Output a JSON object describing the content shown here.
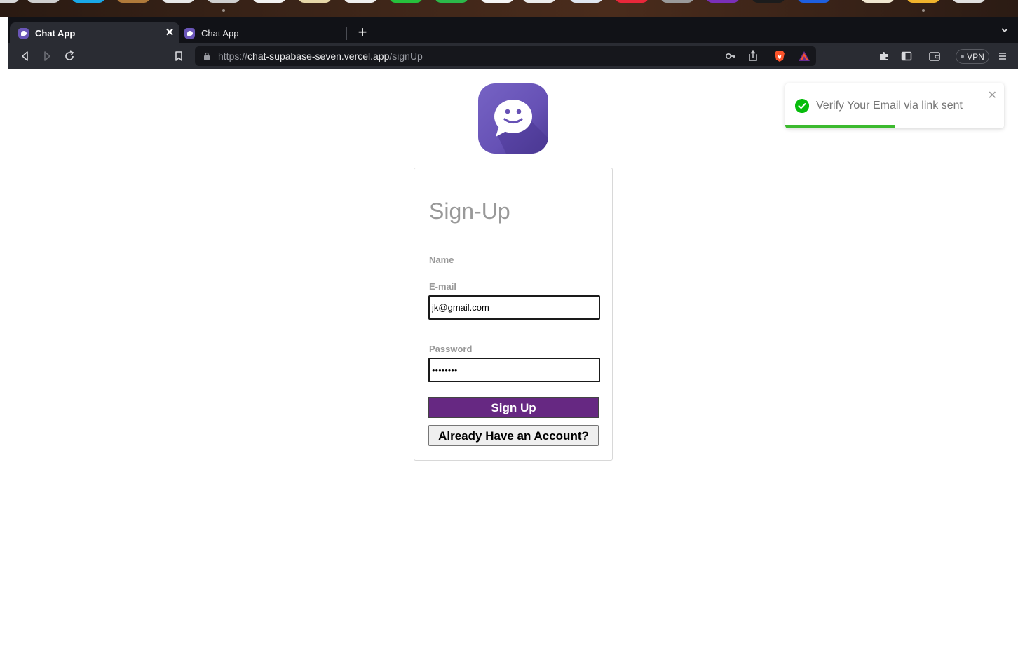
{
  "browser": {
    "tabs": [
      {
        "label": "Chat App",
        "active": true
      },
      {
        "label": "Chat App",
        "active": false
      }
    ],
    "address": {
      "scheme": "https://",
      "host": "chat-supabase-seven.vercel.app",
      "path": "/signUp"
    },
    "vpn_label": "VPN"
  },
  "signup": {
    "title": "Sign-Up",
    "name_label": "Name",
    "email_label": "E-mail",
    "email_value": "jk@gmail.com",
    "password_label": "Password",
    "password_value": "password",
    "signup_button": "Sign Up",
    "login_button": "Already Have an Account?"
  },
  "toast": {
    "message": "Verify Your Email via link sent",
    "progress_fraction": 0.5
  },
  "colors": {
    "brand_purple": "#662882",
    "logo_purple": "#6651b5",
    "toast_success": "#07bc0c"
  }
}
